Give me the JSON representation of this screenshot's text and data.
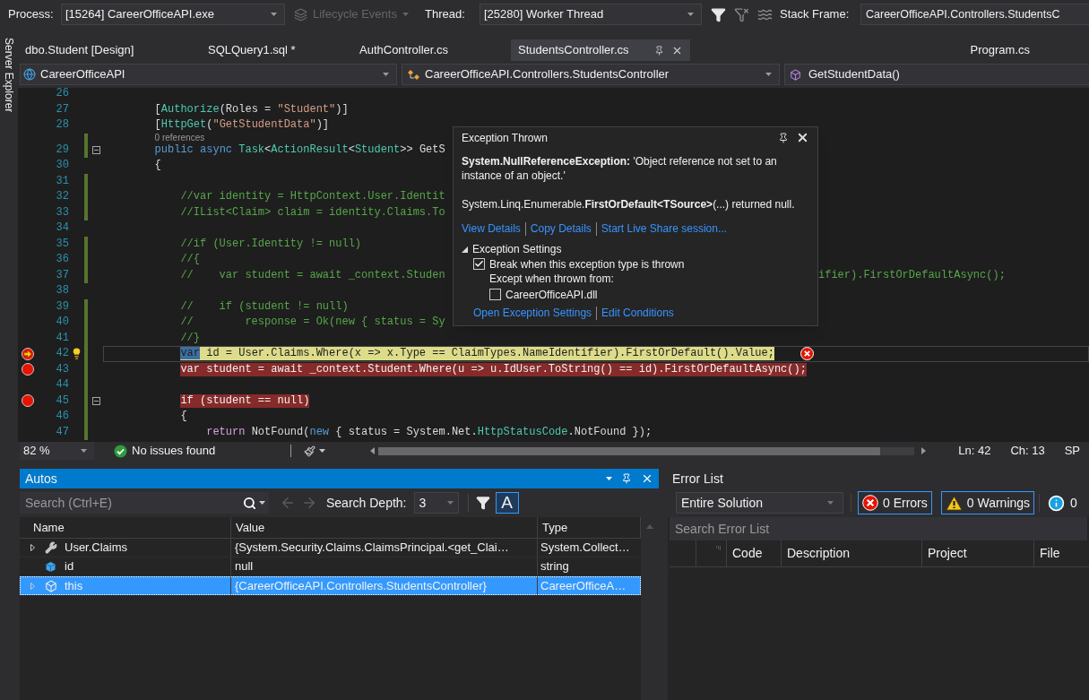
{
  "debug_toolbar": {
    "process_label": "Process:",
    "process": "[15264] CareerOfficeAPI.exe",
    "lifecycle_events": {
      "label": "Lifecycle Events",
      "disabled": true
    },
    "thread_label": "Thread:",
    "thread": "[25280] Worker Thread",
    "stack_frame_label": "Stack Frame:",
    "stack_frame": "CareerOfficeAPI.Controllers.StudentsC"
  },
  "side_strip": {
    "label": "Server Explorer"
  },
  "tabs": [
    {
      "label": "dbo.Student [Design]",
      "selected": false
    },
    {
      "label": "SQLQuery1.sql *",
      "selected": false
    },
    {
      "label": "AuthController.cs",
      "selected": false
    },
    {
      "label": "StudentsController.cs",
      "selected": true
    },
    {
      "label": "Program.cs",
      "selected": false
    }
  ],
  "nav_bar": {
    "project": "CareerOfficeAPI",
    "class": "CareerOfficeAPI.Controllers.StudentsController",
    "member": "GetStudentData()"
  },
  "code_lines": [
    {
      "number": "26",
      "changed": false,
      "fold": false,
      "breakpoint": false,
      "current": false
    },
    {
      "number": "27",
      "changed": false,
      "fold": false,
      "breakpoint": false,
      "current": false,
      "tokens": [
        {
          "text": "        [",
          "kind": "plain"
        },
        {
          "text": "Authorize",
          "kind": "type"
        },
        {
          "text": "(Roles = ",
          "kind": "plain"
        },
        {
          "text": "\"Student\"",
          "kind": "string"
        },
        {
          "text": ")]",
          "kind": "plain"
        }
      ]
    },
    {
      "number": "28",
      "changed": false,
      "fold": false,
      "breakpoint": false,
      "current": false,
      "tokens": [
        {
          "text": "        [",
          "kind": "plain"
        },
        {
          "text": "HttpGet",
          "kind": "type"
        },
        {
          "text": "(",
          "kind": "plain"
        },
        {
          "text": "\"GetStudentData\"",
          "kind": "string"
        },
        {
          "text": ")]",
          "kind": "plain"
        }
      ]
    },
    {
      "number": "29",
      "changed": true,
      "fold": true,
      "breakpoint": false,
      "current": false,
      "codelens": "0 references",
      "tokens": [
        {
          "text": "        public",
          "kind": "keyword"
        },
        {
          "text": " async",
          "kind": "keyword"
        },
        {
          "text": " Task",
          "kind": "type"
        },
        {
          "text": "<",
          "kind": "plain"
        },
        {
          "text": "ActionResult",
          "kind": "type"
        },
        {
          "text": "<",
          "kind": "plain"
        },
        {
          "text": "Student",
          "kind": "type"
        },
        {
          "text": ">> GetS",
          "kind": "plain"
        }
      ]
    },
    {
      "number": "30",
      "changed": false,
      "fold": false,
      "breakpoint": false,
      "current": false,
      "tokens": [
        {
          "text": "        {",
          "kind": "plain"
        }
      ]
    },
    {
      "number": "31",
      "changed": true,
      "fold": false,
      "breakpoint": false,
      "current": false
    },
    {
      "number": "32",
      "changed": true,
      "fold": false,
      "breakpoint": false,
      "current": false,
      "tokens": [
        {
          "text": "            //var identity = HttpContext.User.Identit",
          "kind": "comment"
        }
      ]
    },
    {
      "number": "33",
      "changed": true,
      "fold": false,
      "breakpoint": false,
      "current": false,
      "tokens": [
        {
          "text": "            //IList<Claim> claim = identity.Claims.To",
          "kind": "comment"
        }
      ]
    },
    {
      "number": "34",
      "changed": false,
      "fold": false,
      "breakpoint": false,
      "current": false
    },
    {
      "number": "35",
      "changed": true,
      "fold": false,
      "breakpoint": false,
      "current": false,
      "tokens": [
        {
          "text": "            //if (User.Identity != null)",
          "kind": "comment"
        }
      ]
    },
    {
      "number": "36",
      "changed": true,
      "fold": false,
      "breakpoint": false,
      "current": false,
      "tokens": [
        {
          "text": "            //{",
          "kind": "comment"
        }
      ]
    },
    {
      "number": "37",
      "changed": true,
      "fold": false,
      "breakpoint": false,
      "current": false,
      "tokens": [
        {
          "text": "            //    var student = await _context.Studen",
          "kind": "comment"
        }
      ],
      "tail": "ifier).FirstOrDefaultAsync();"
    },
    {
      "number": "38",
      "changed": false,
      "fold": false,
      "breakpoint": false,
      "current": false
    },
    {
      "number": "39",
      "changed": true,
      "fold": false,
      "breakpoint": false,
      "current": false,
      "tokens": [
        {
          "text": "            //    if (student != null)",
          "kind": "comment"
        }
      ]
    },
    {
      "number": "40",
      "changed": true,
      "fold": false,
      "breakpoint": false,
      "current": false,
      "tokens": [
        {
          "text": "            //        response = Ok(new { status = Sy",
          "kind": "comment"
        }
      ]
    },
    {
      "number": "41",
      "changed": true,
      "fold": false,
      "breakpoint": false,
      "current": false,
      "tokens": [
        {
          "text": "            //}",
          "kind": "comment"
        }
      ]
    },
    {
      "number": "42",
      "changed": true,
      "fold": false,
      "breakpoint": true,
      "current": true,
      "tokens": [
        {
          "text": "            var",
          "kind": "selection"
        },
        {
          "text": " id = User.Claims.Where(x => x.Type == ClaimTypes.NameIdentifier).FirstOrDefault().Value;",
          "kind": "plain"
        }
      ]
    },
    {
      "number": "43",
      "changed": true,
      "fold": false,
      "breakpoint": true,
      "current": false,
      "tokens": [
        {
          "text": "            var student = await _context.Student.Where(u => u.IdUser.ToString() == id).FirstOrDefaultAsync();",
          "kind": "plain"
        }
      ]
    },
    {
      "number": "44",
      "changed": true,
      "fold": false,
      "breakpoint": false,
      "current": false
    },
    {
      "number": "45",
      "changed": true,
      "fold": true,
      "breakpoint": true,
      "current": false,
      "tokens": [
        {
          "text": "            if (student == null)",
          "kind": "plain"
        }
      ]
    },
    {
      "number": "46",
      "changed": true,
      "fold": false,
      "breakpoint": false,
      "current": false,
      "tokens": [
        {
          "text": "            {",
          "kind": "plain"
        }
      ]
    },
    {
      "number": "47",
      "changed": true,
      "fold": false,
      "breakpoint": false,
      "current": false,
      "tokens": [
        {
          "text": "                return",
          "kind": "control"
        },
        {
          "text": " NotFound(",
          "kind": "plain"
        },
        {
          "text": "new",
          "kind": "keyword"
        },
        {
          "text": " { status = System.Net.",
          "kind": "plain"
        },
        {
          "text": "HttpStatusCode",
          "kind": "type"
        },
        {
          "text": ".NotFound });",
          "kind": "plain"
        }
      ]
    }
  ],
  "exception_popup": {
    "title": "Exception Thrown",
    "message": "**System.NullReferenceException:** 'Object reference not set to an instance of an object.'",
    "detail": "System.Linq.Enumerable.**FirstOrDefault<TSource>**(...) returned null.",
    "links": [
      "View Details",
      "Copy Details",
      "Start Live Share session..."
    ],
    "settings": {
      "title": "Exception Settings",
      "expanded": true,
      "break_option": {
        "label": "Break when this exception type is thrown",
        "checked": true
      },
      "except_label": "Except when thrown from:",
      "except_option": {
        "label": "CareerOfficeAPI.dll",
        "checked": false
      },
      "links": [
        "Open Exception Settings",
        "Edit Conditions"
      ]
    }
  },
  "editor_status": {
    "zoom": "82 %",
    "issues": "No issues found",
    "line": "Ln: 42",
    "column": "Ch: 13",
    "column_3": "SP"
  },
  "autos": {
    "title": "Autos",
    "search_placeholder": "Search (Ctrl+E)",
    "depth_label": "Search Depth:",
    "depth": "3",
    "hex_toggle": {
      "label": "A",
      "on": true
    },
    "columns": [
      "Name",
      "Value",
      "Type"
    ],
    "rows": [
      {
        "kind": "property",
        "name": "User.Claims",
        "value": "{System.Security.Claims.ClaimsPrincipal.<get_Clai…",
        "type": "System.Collect…",
        "expandable": true,
        "selected": false
      },
      {
        "kind": "field",
        "name": "id",
        "value": "null",
        "type": "string",
        "expandable": false,
        "selected": false
      },
      {
        "kind": "object",
        "name": "this",
        "value": "{CareerOfficeAPI.Controllers.StudentsController}",
        "type": "CareerOfficeA…",
        "expandable": true,
        "selected": true
      }
    ]
  },
  "error_list": {
    "title": "Error List",
    "scope": "Entire Solution",
    "errors": "0 Errors",
    "warnings": "0 Warnings",
    "messages": "0",
    "search_placeholder": "Search Error List",
    "columns": [
      "Code",
      "Description",
      "Project",
      "File"
    ]
  }
}
